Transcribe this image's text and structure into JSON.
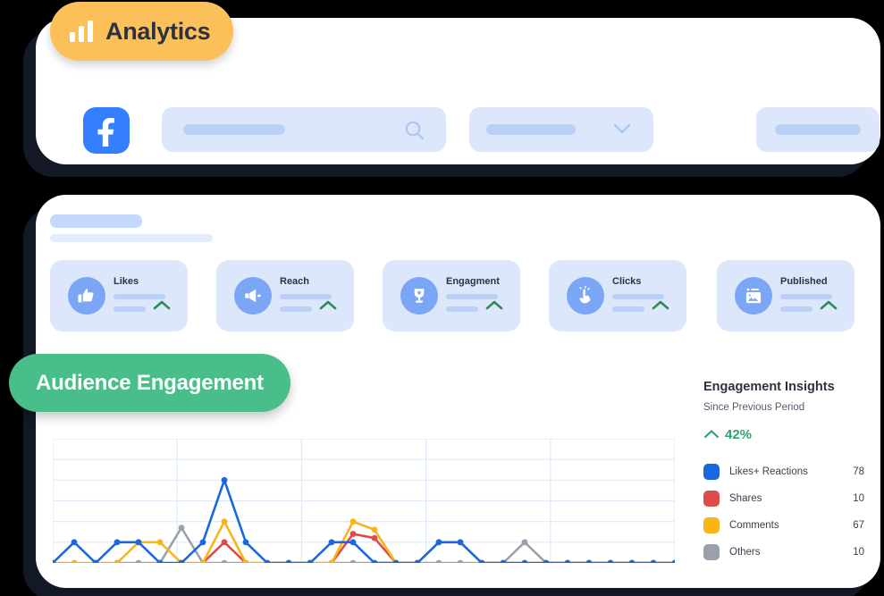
{
  "header": {
    "pill_label": "Analytics",
    "pill_icon": "bar-chart-icon",
    "pill_color": "#FBC05A",
    "platform_icon": "facebook-logo",
    "platform_color": "#337FFF",
    "search_placeholder": "",
    "search_value": "",
    "search_icon": "search-icon",
    "select_value": "",
    "select_icon": "chevron-down-icon",
    "action_label": ""
  },
  "main": {
    "skeleton_title": "",
    "skeleton_subtitle": "",
    "stats": [
      {
        "label": "Likes",
        "icon": "thumbs-up-icon",
        "trend": "up"
      },
      {
        "label": "Reach",
        "icon": "megaphone-icon",
        "trend": "up"
      },
      {
        "label": "Engagment",
        "icon": "trophy-icon",
        "trend": "up"
      },
      {
        "label": "Clicks",
        "icon": "click-hand-icon",
        "trend": "up"
      },
      {
        "label": "Published",
        "icon": "image-icon",
        "trend": "up"
      }
    ],
    "section_pill": {
      "label": "Audience Engagement",
      "color": "#49BE8A"
    }
  },
  "insights": {
    "title": "Engagement Insights",
    "subtitle": "Since Previous Period",
    "change_value": "42%",
    "change_direction": "up",
    "change_color": "#2ea36a",
    "legend": [
      {
        "label": "Likes+ Reactions",
        "value": "78",
        "color": "#1A68DF"
      },
      {
        "label": "Shares",
        "value": "10",
        "color": "#DE4B4B"
      },
      {
        "label": "Comments",
        "value": "67",
        "color": "#F9B518"
      },
      {
        "label": "Others",
        "value": "10",
        "color": "#9AA1AB"
      }
    ]
  },
  "chart_data": {
    "type": "line",
    "title": "Audience Engagement",
    "xlabel": "",
    "ylabel": "",
    "grid": true,
    "legend_position": "right",
    "ylim": [
      0,
      6
    ],
    "x": [
      0,
      1,
      2,
      3,
      4,
      5,
      6,
      7,
      8,
      9,
      10,
      11,
      12,
      13,
      14,
      15,
      16,
      17,
      18,
      19,
      20,
      21,
      22,
      23,
      24,
      25,
      26,
      27,
      28,
      29
    ],
    "xtick_labels": [],
    "gridlines_y": [
      0,
      1,
      2,
      3,
      4,
      5,
      6
    ],
    "gridlines_x": [
      0,
      6,
      12,
      18,
      24,
      30
    ],
    "series": [
      {
        "name": "Likes+ Reactions",
        "color": "#1A68DF",
        "total": 78,
        "values": [
          0,
          1,
          0,
          1,
          1,
          0,
          0,
          1,
          4,
          1,
          0,
          0,
          0,
          1,
          1,
          0,
          0,
          0,
          1,
          1,
          0,
          0,
          0,
          0,
          0,
          0,
          0,
          0,
          0,
          0
        ]
      },
      {
        "name": "Shares",
        "color": "#DE4B4B",
        "total": 10,
        "values": [
          null,
          null,
          null,
          null,
          null,
          null,
          null,
          0,
          1,
          0,
          null,
          null,
          null,
          0,
          1.4,
          1.2,
          0,
          null,
          null,
          null,
          null,
          null,
          null,
          null,
          null,
          null,
          null,
          null,
          null,
          null
        ]
      },
      {
        "name": "Comments",
        "color": "#F9B518",
        "total": 67,
        "values": [
          0,
          0,
          0,
          0,
          1,
          1,
          0,
          0,
          2,
          0,
          0,
          0,
          0,
          0,
          2,
          1.6,
          0,
          0,
          1,
          1,
          0,
          0,
          0,
          0,
          0,
          0,
          0,
          0,
          0,
          0
        ]
      },
      {
        "name": "Others",
        "color": "#9AA1AB",
        "total": 10,
        "values": [
          null,
          null,
          null,
          0,
          0,
          0,
          1.7,
          0,
          0,
          0,
          0,
          0,
          0,
          0,
          0,
          0,
          0,
          0,
          0,
          0,
          0,
          0,
          1,
          0,
          0,
          0,
          0,
          0,
          0,
          0
        ]
      }
    ]
  }
}
